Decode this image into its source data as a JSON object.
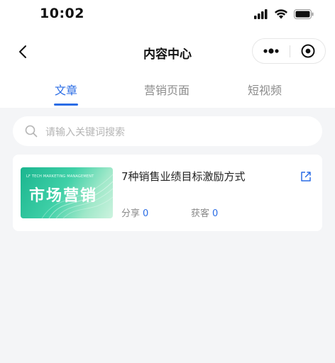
{
  "status_bar": {
    "time": "10:02",
    "icons": [
      "signal-icon",
      "wifi-icon",
      "battery-icon"
    ]
  },
  "nav_bar": {
    "title": "内容中心",
    "back_icon": "chevron-left-icon",
    "more_icon": "more-dots-icon",
    "close_icon": "target-circle-icon"
  },
  "tabs": [
    {
      "label": "文章",
      "active": true
    },
    {
      "label": "营销页面",
      "active": false
    },
    {
      "label": "短视频",
      "active": false
    }
  ],
  "search": {
    "placeholder": "请输入关键词搜索",
    "value": ""
  },
  "articles": [
    {
      "thumbnail": {
        "small_text": "LF TECH MARKETING MANAGEMENT",
        "text": "市场营销"
      },
      "title": "7种销售业绩目标激励方式",
      "share_label": "分享",
      "share_count": "0",
      "lead_label": "获客",
      "lead_count": "0"
    }
  ],
  "colors": {
    "accent": "#2b6de5",
    "background": "#f4f5f7",
    "thumbnail_green": "#3fd0a7"
  }
}
